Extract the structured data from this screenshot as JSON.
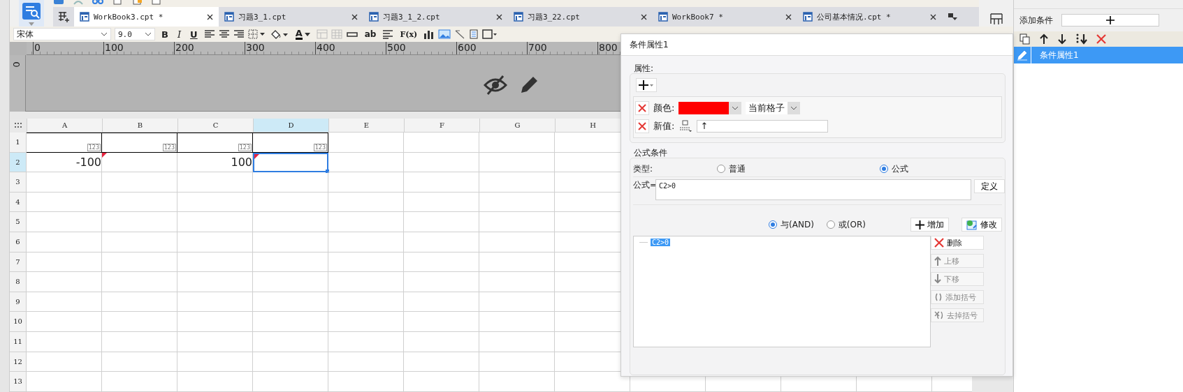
{
  "tabs": [
    {
      "label": "WorkBook3.cpt *",
      "selected": true
    },
    {
      "label": "习题3_1.cpt",
      "selected": false
    },
    {
      "label": "习题3_1_2.cpt",
      "selected": false
    },
    {
      "label": "习题3_22.cpt",
      "selected": false
    },
    {
      "label": "WorkBook7 *",
      "selected": false
    },
    {
      "label": "公司基本情况.cpt *",
      "selected": false
    }
  ],
  "toolbar": {
    "font": "宋体",
    "size": "9.0",
    "bold": "B",
    "italic": "I",
    "underline": "U",
    "font_color": "A",
    "text_tool": "ab",
    "formula_tool": "F(x)"
  },
  "ruler": {
    "marks": [
      "0",
      "100",
      "200",
      "300",
      "400",
      "500",
      "600",
      "700",
      "800"
    ],
    "vertical": "0"
  },
  "sheet": {
    "columns": [
      {
        "label": "A",
        "selected": false
      },
      {
        "label": "B",
        "selected": false
      },
      {
        "label": "C",
        "selected": false
      },
      {
        "label": "D",
        "selected": true
      },
      {
        "label": "E",
        "selected": false
      },
      {
        "label": "F",
        "selected": false
      },
      {
        "label": "G",
        "selected": false
      },
      {
        "label": "H",
        "selected": false
      }
    ],
    "rows": [
      {
        "label": "1",
        "selected": false,
        "cells": [
          {
            "badge": "123",
            "boxed": true,
            "flag": false,
            "selected": false
          },
          {
            "badge": "123",
            "boxed": true,
            "flag": false,
            "selected": false
          },
          {
            "badge": "123",
            "boxed": true,
            "flag": false,
            "selected": false
          },
          {
            "badge": "123",
            "boxed": true,
            "flag": false,
            "selected": false
          }
        ]
      },
      {
        "label": "2",
        "selected": true,
        "cells": [
          {
            "text": "-100",
            "boxed": false,
            "flag": false,
            "selected": false
          },
          {
            "boxed": false,
            "flag": true,
            "selected": false
          },
          {
            "text": "100",
            "boxed": false,
            "flag": false,
            "selected": false
          },
          {
            "boxed": false,
            "flag": true,
            "selected": true
          }
        ]
      },
      {
        "label": "3",
        "selected": false
      },
      {
        "label": "4",
        "selected": false
      },
      {
        "label": "5",
        "selected": false
      },
      {
        "label": "6",
        "selected": false
      },
      {
        "label": "7",
        "selected": false
      },
      {
        "label": "8",
        "selected": false
      },
      {
        "label": "9",
        "selected": false
      },
      {
        "label": "10",
        "selected": false
      },
      {
        "label": "11",
        "selected": false
      },
      {
        "label": "12",
        "selected": false
      },
      {
        "label": "13",
        "selected": false
      }
    ]
  },
  "dialog": {
    "title": "条件属性1",
    "attributes": {
      "legend": "属性:",
      "rows": [
        {
          "kind": "color",
          "label": "颜色:",
          "color": "#ff0000",
          "scope": "当前格子"
        },
        {
          "kind": "value",
          "label": "新值:",
          "value": "↑"
        }
      ]
    },
    "formula": {
      "legend": "公式条件",
      "type_label": "类型:",
      "types": [
        {
          "label": "普通",
          "selected": false
        },
        {
          "label": "公式",
          "selected": true
        }
      ],
      "formula_label": "公式=",
      "formula": "C2>0",
      "define_button": "定义",
      "joins": [
        {
          "label": "与(AND)",
          "selected": true
        },
        {
          "label": "或(OR)",
          "selected": false
        }
      ],
      "add_button": "增加",
      "edit_button": "修改",
      "conditions": [
        {
          "text": "C2>0",
          "selected": true
        }
      ],
      "side_buttons": [
        {
          "kind": "delete",
          "label": "删除",
          "disabled": false
        },
        {
          "kind": "up",
          "label": "上移",
          "disabled": true
        },
        {
          "kind": "down",
          "label": "下移",
          "disabled": true
        },
        {
          "kind": "add-bracket",
          "label": "添加括号",
          "disabled": true
        },
        {
          "kind": "remove-bracket",
          "label": "去掉括号",
          "disabled": true
        }
      ]
    }
  },
  "panel": {
    "add_label": "添加条件",
    "items": [
      {
        "label": "条件属性1",
        "selected": true
      }
    ]
  }
}
